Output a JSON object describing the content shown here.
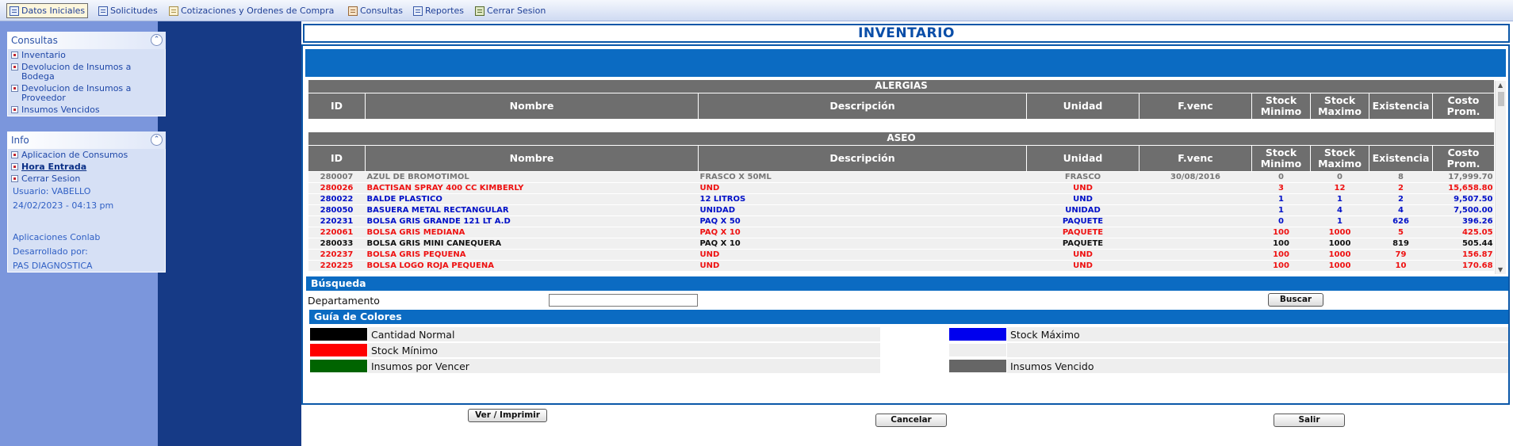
{
  "menu": [
    {
      "label": "Datos Iniciales",
      "icon": "form-icon",
      "active": true
    },
    {
      "label": "Solicitudes",
      "icon": "list-icon"
    },
    {
      "label": "Cotizaciones y Ordenes de Compra",
      "icon": "pencil-icon"
    },
    {
      "label": "Consultas",
      "icon": "calendar-icon"
    },
    {
      "label": "Reportes",
      "icon": "report-icon"
    },
    {
      "label": "Cerrar Sesion",
      "icon": "exit-icon"
    }
  ],
  "consultas_panel": {
    "title": "Consultas",
    "items": [
      "Inventario",
      "Devolucion de Insumos a Bodega",
      "Devolucion de Insumos a Proveedor",
      "Insumos Vencidos"
    ]
  },
  "info_panel": {
    "title": "Info",
    "items": [
      "Aplicacion de Consumos",
      "Hora Entrada",
      "Cerrar Sesion"
    ],
    "usuario": "Usuario: VABELLO",
    "fecha": "24/02/2023 - 04:13 pm",
    "app_name": "Aplicaciones Conlab",
    "dev_label": "Desarrollado por:",
    "dev_name": "PAS DIAGNOSTICA"
  },
  "page_title": "INVENTARIO",
  "table": {
    "columns": [
      "ID",
      "Nombre",
      "Descripción",
      "Unidad",
      "F.venc",
      "Stock Minimo",
      "Stock Maximo",
      "Existencia",
      "Costo Prom."
    ],
    "groups": [
      {
        "name": "ALERGIAS",
        "rows": []
      },
      {
        "name": "ASEO",
        "rows": [
          {
            "color": "gray",
            "cells": [
              "280007",
              "AZUL DE BROMOTIMOL",
              "FRASCO X 50ML",
              "FRASCO",
              "30/08/2016",
              "0",
              "0",
              "8",
              "17,999.70"
            ]
          },
          {
            "color": "red",
            "cells": [
              "280026",
              "BACTISAN SPRAY 400 CC KIMBERLY",
              "UND",
              "UND",
              "",
              "3",
              "12",
              "2",
              "15,658.80"
            ]
          },
          {
            "color": "blue",
            "cells": [
              "280022",
              "BALDE PLASTICO",
              "12 LITROS",
              "UND",
              "",
              "1",
              "1",
              "2",
              "9,507.50"
            ]
          },
          {
            "color": "blue",
            "cells": [
              "280050",
              "BASUERA METAL RECTANGULAR",
              "UNIDAD",
              "UNIDAD",
              "",
              "1",
              "4",
              "4",
              "7,500.00"
            ]
          },
          {
            "color": "blue",
            "cells": [
              "220231",
              "BOLSA GRIS GRANDE 121 LT A.D",
              "PAQ X 50",
              "PAQUETE",
              "",
              "0",
              "1",
              "626",
              "396.26"
            ]
          },
          {
            "color": "red",
            "cells": [
              "220061",
              "BOLSA GRIS MEDIANA",
              "PAQ X 10",
              "PAQUETE",
              "",
              "100",
              "1000",
              "5",
              "425.05"
            ]
          },
          {
            "color": "black",
            "cells": [
              "280033",
              "BOLSA GRIS MINI CANEQUERA",
              "PAQ X 10",
              "PAQUETE",
              "",
              "100",
              "1000",
              "819",
              "505.44"
            ]
          },
          {
            "color": "red",
            "cells": [
              "220237",
              "BOLSA GRIS PEQUENA",
              "UND",
              "UND",
              "",
              "100",
              "1000",
              "79",
              "156.87"
            ]
          },
          {
            "color": "red",
            "cells": [
              "220225",
              "BOLSA LOGO ROJA PEQUENA",
              "UND",
              "UND",
              "",
              "100",
              "1000",
              "10",
              "170.68"
            ]
          }
        ]
      }
    ]
  },
  "search": {
    "title": "Búsqueda",
    "label": "Departamento",
    "value": "",
    "button": "Buscar"
  },
  "guide": {
    "title": "Guía de Colores",
    "items": [
      {
        "label": "Cantidad Normal",
        "color": "#000000"
      },
      {
        "label": "Stock Máximo",
        "color": "#0000ee"
      },
      {
        "label": "Stock Mínimo",
        "color": "#ff0000"
      },
      {
        "label": "",
        "color": ""
      },
      {
        "label": "Insumos por Vencer",
        "color": "#006400"
      },
      {
        "label": "Insumos Vencido",
        "color": "#666666"
      }
    ]
  },
  "buttons": {
    "ver_imprimir": "Ver / Imprimir",
    "cancelar": "Cancelar",
    "salir": "Salir"
  }
}
